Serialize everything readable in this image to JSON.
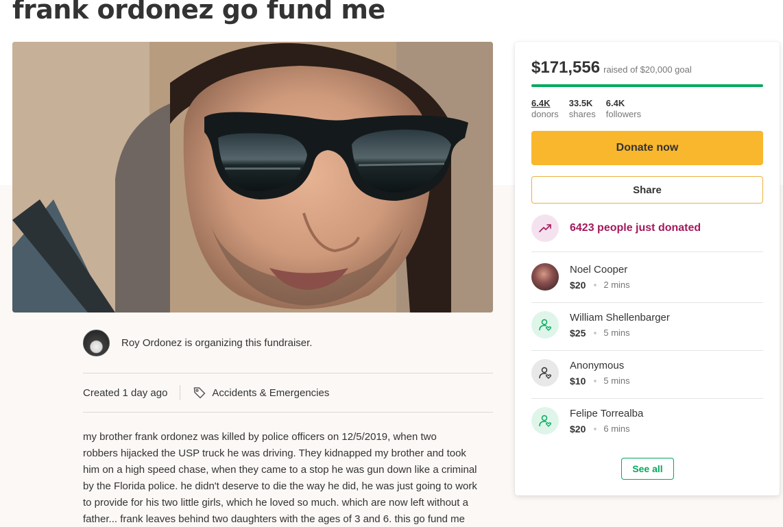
{
  "page": {
    "title": "frank ordonez go fund me"
  },
  "organizer": {
    "text": "Roy Ordonez is organizing this fundraiser."
  },
  "meta": {
    "created": "Created 1 day ago",
    "category": "Accidents & Emergencies"
  },
  "story": {
    "lines": [
      "my brother frank ordonez was killed by police officers  on 12/5/2019, when two",
      "robbers hijacked the USP truck he was driving.  They kidnapped my brother and took",
      "him on a high speed chase, when they came to a stop he was gun down like a criminal",
      "by the Florida police. he didn't deserve to die the way he did, he was just going to work",
      "to provide for his two little girls, which he loved so much. which are now left without a",
      "father... frank leaves behind two daughters with the ages of 3 and 6. this go fund me"
    ]
  },
  "sidebar": {
    "raised": "$171,556",
    "goal_text": "raised of $20,000 goal",
    "progress_fraction": 1.0,
    "stats": [
      {
        "value": "6.4K",
        "label": "donors",
        "linked": true
      },
      {
        "value": "33.5K",
        "label": "shares",
        "linked": false
      },
      {
        "value": "6.4K",
        "label": "followers",
        "linked": false
      }
    ],
    "donate_label": "Donate now",
    "share_label": "Share",
    "trend_text": "6423 people just donated",
    "donations": [
      {
        "name": "Noel Cooper",
        "amount": "$20",
        "time": "2 mins",
        "avatar": "photo"
      },
      {
        "name": "William Shellenbarger",
        "amount": "$25",
        "time": "5 mins",
        "avatar": "heart-person-icon"
      },
      {
        "name": "Anonymous",
        "amount": "$10",
        "time": "5 mins",
        "avatar": "heart-person-icon"
      },
      {
        "name": "Felipe Torrealba",
        "amount": "$20",
        "time": "6 mins",
        "avatar": "heart-person-icon"
      }
    ],
    "see_all_label": "See all"
  },
  "colors": {
    "brand_green": "#02a95c",
    "donate_yellow": "#f9b72d",
    "trend_magenta": "#a3195b"
  }
}
